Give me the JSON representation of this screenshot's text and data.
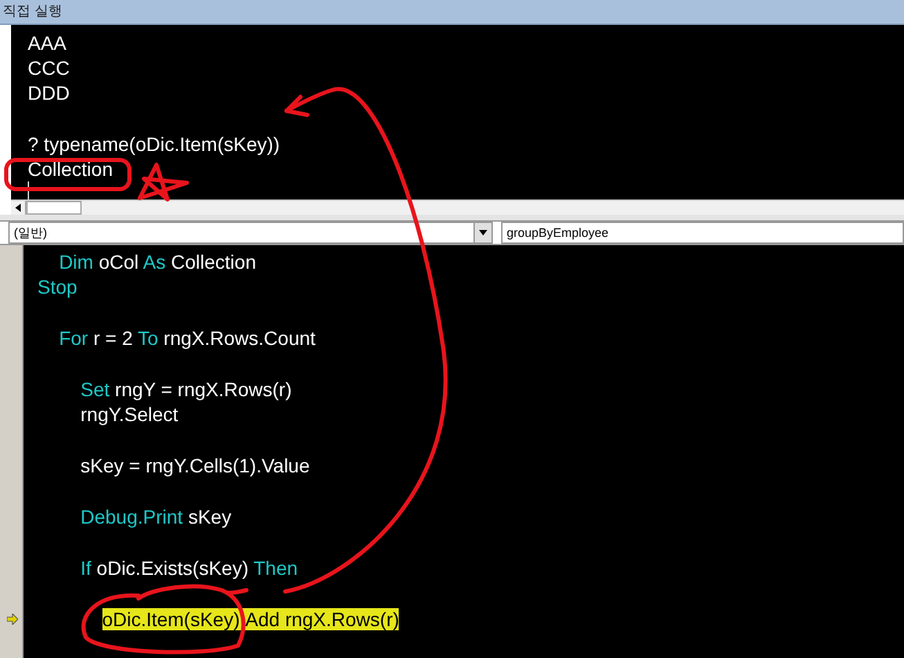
{
  "immediate_window": {
    "title": "직접 실행",
    "lines": [
      {
        "text": "AAA",
        "gap_before": false
      },
      {
        "text": "CCC",
        "gap_before": false
      },
      {
        "text": "DDD",
        "gap_before": false
      },
      {
        "text": "? typename(oDic.Item(sKey))",
        "gap_before": true
      },
      {
        "text": "Collection",
        "gap_before": false
      }
    ]
  },
  "code_window": {
    "object_dropdown": "(일반)",
    "procedure_dropdown": "groupByEmployee",
    "lines": [
      {
        "current": false,
        "gap_before": false,
        "tokens": [
          {
            "kind": "keyword",
            "text": "    Dim"
          },
          {
            "kind": "plain",
            "text": " oCol "
          },
          {
            "kind": "keyword",
            "text": "As"
          },
          {
            "kind": "plain",
            "text": " Collection"
          }
        ]
      },
      {
        "current": false,
        "gap_before": false,
        "tokens": [
          {
            "kind": "keyword",
            "text": "Stop"
          }
        ]
      },
      {
        "current": false,
        "gap_before": true,
        "tokens": [
          {
            "kind": "keyword",
            "text": "    For"
          },
          {
            "kind": "plain",
            "text": " r = 2 "
          },
          {
            "kind": "keyword",
            "text": "To"
          },
          {
            "kind": "plain",
            "text": " rngX.Rows.Count"
          }
        ]
      },
      {
        "current": false,
        "gap_before": true,
        "tokens": [
          {
            "kind": "keyword",
            "text": "        Set"
          },
          {
            "kind": "plain",
            "text": " rngY = rngX.Rows(r)"
          }
        ]
      },
      {
        "current": false,
        "gap_before": false,
        "tokens": [
          {
            "kind": "plain",
            "text": "        rngY.Select"
          }
        ]
      },
      {
        "current": false,
        "gap_before": true,
        "tokens": [
          {
            "kind": "plain",
            "text": "        sKey = rngY.Cells(1).Value"
          }
        ]
      },
      {
        "current": false,
        "gap_before": true,
        "tokens": [
          {
            "kind": "keyword",
            "text": "        Debug.Print"
          },
          {
            "kind": "plain",
            "text": " sKey"
          }
        ]
      },
      {
        "current": false,
        "gap_before": true,
        "tokens": [
          {
            "kind": "keyword",
            "text": "        If"
          },
          {
            "kind": "plain",
            "text": " oDic.Exists(sKey) "
          },
          {
            "kind": "keyword",
            "text": "Then"
          }
        ]
      },
      {
        "current": true,
        "gap_before": true,
        "tokens": [
          {
            "kind": "plain",
            "text": "            oDic.Item(sKey).Add rngX.Rows(r)"
          }
        ]
      }
    ]
  }
}
